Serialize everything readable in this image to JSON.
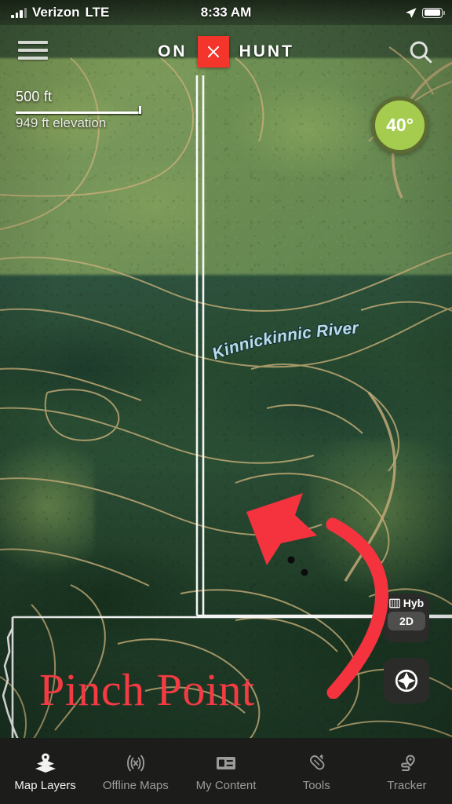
{
  "status_bar": {
    "carrier": "Verizon",
    "network": "LTE",
    "time": "8:33 AM",
    "signal_icon": "signal-bars-icon",
    "location_icon": "location-arrow-icon",
    "battery_icon": "battery-icon"
  },
  "header": {
    "menu_icon": "hamburger-menu-icon",
    "logo_prefix": "ON",
    "logo_mark_icon": "x-mark-icon",
    "logo_suffix": "HUNT",
    "search_icon": "search-icon"
  },
  "scale_bar": {
    "distance": "500 ft",
    "elevation": "949 ft elevation"
  },
  "temperature_badge": {
    "value": "40°",
    "fill_color": "#a5cc4e",
    "ring_color": "#5c6b34"
  },
  "map": {
    "river_label": "Kinnickinnic River",
    "river_label_color": "#b9dced",
    "contour_color": "#c9b07a",
    "boundary_color": "#ffffff",
    "waypoint_count": 2
  },
  "annotations": {
    "arrow_icon": "curved-arrow-annotation-icon",
    "arrow_color": "#f4333f",
    "caption": "Pinch Point",
    "caption_color": "#f43b44"
  },
  "map_controls": {
    "layer_icon": "map-layers-book-icon",
    "layer_label": "Hyb",
    "dimension_label": "2D",
    "locate_icon": "compass-locate-icon"
  },
  "bottom_nav": {
    "items": [
      {
        "label": "Map Layers",
        "icon": "map-layers-icon",
        "active": true
      },
      {
        "label": "Offline Maps",
        "icon": "offline-maps-icon",
        "active": false
      },
      {
        "label": "My Content",
        "icon": "my-content-icon",
        "active": false
      },
      {
        "label": "Tools",
        "icon": "tools-icon",
        "active": false
      },
      {
        "label": "Tracker",
        "icon": "tracker-icon",
        "active": false
      }
    ]
  }
}
